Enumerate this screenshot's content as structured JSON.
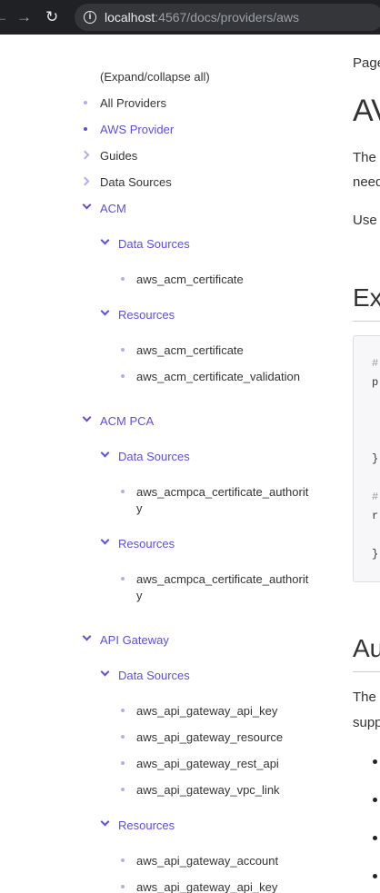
{
  "browser": {
    "url_host": "localhost",
    "url_path": ":4567/docs/providers/aws",
    "info_glyph": "i"
  },
  "sidebar": {
    "expand_all": "(Expand/collapse all)",
    "all_providers": "All Providers",
    "aws_provider": "AWS Provider",
    "guides": "Guides",
    "data_sources": "Data Sources",
    "acm": {
      "label": "ACM",
      "data_sources_label": "Data Sources",
      "data_sources": [
        "aws_acm_certificate"
      ],
      "resources_label": "Resources",
      "resources": [
        "aws_acm_certificate",
        "aws_acm_certificate_validation"
      ]
    },
    "acm_pca": {
      "label": "ACM PCA",
      "data_sources_label": "Data Sources",
      "data_sources": [
        "aws_acmpca_certificate_authority"
      ],
      "resources_label": "Resources",
      "resources": [
        "aws_acmpca_certificate_authority"
      ]
    },
    "api_gateway": {
      "label": "API Gateway",
      "data_sources_label": "Data Sources",
      "data_sources": [
        "aws_api_gateway_api_key",
        "aws_api_gateway_resource",
        "aws_api_gateway_rest_api",
        "aws_api_gateway_vpc_link"
      ],
      "resources_label": "Resources",
      "resources": [
        "aws_api_gateway_account",
        "aws_api_gateway_api_key"
      ]
    }
  },
  "main": {
    "page_label": "Page",
    "title": "AV",
    "intro_line1": "The",
    "intro_line2": "need",
    "use_line": "Use",
    "example_heading": "Ex",
    "code": {
      "line1": "#",
      "line2": "p",
      "line3": "}",
      "line4": "#",
      "line5": "r",
      "line6": "}"
    },
    "auth_heading": "Au",
    "auth_line1": "The",
    "auth_line2": "supp"
  }
}
